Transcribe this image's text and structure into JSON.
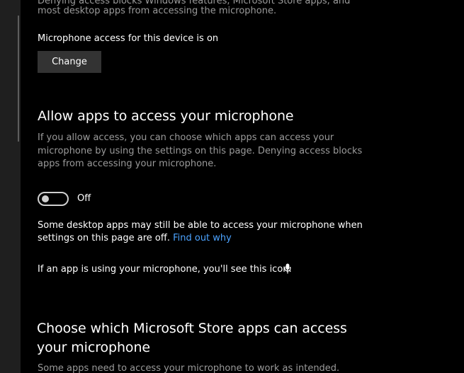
{
  "intro": {
    "desc_line1": "Denying access blocks Windows features, Microsoft Store apps, and",
    "desc_line2": "most desktop apps from accessing the microphone."
  },
  "device_access": {
    "status": "Microphone access for this device is on",
    "change_label": "Change"
  },
  "allow_apps": {
    "title": "Allow apps to access your microphone",
    "desc_line1": "If you allow access, you can choose which apps can access your",
    "desc_line2": "microphone by using the settings on this page. Denying access blocks",
    "desc_line3": "apps from accessing your microphone.",
    "toggle_state": "Off"
  },
  "desktop_note": {
    "line1": "Some desktop apps may still be able to access your microphone when",
    "line2": "settings on this page are off.",
    "link": "Find out why"
  },
  "icon_note": {
    "text": "If an app is using your microphone, you'll see this icon:",
    "icon": "microphone-icon"
  },
  "store_apps": {
    "title_line1": "Choose which Microsoft Store apps can access",
    "title_line2": "your microphone",
    "desc_line1": "Some apps need to access your microphone to work as intended."
  },
  "colors": {
    "background": "#000000",
    "rail": "#1f1f1f",
    "button": "#333333",
    "link": "#4ca3ff",
    "muted_text": "#9a9a9a"
  }
}
